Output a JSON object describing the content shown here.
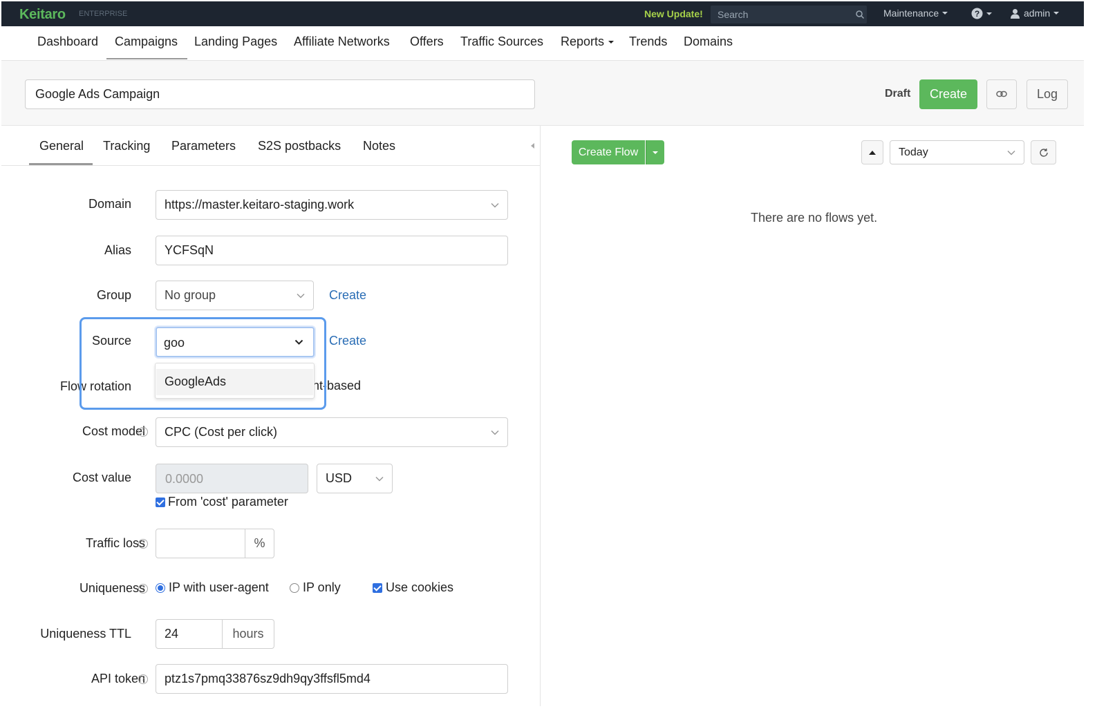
{
  "topbar": {
    "logo": "Keitaro",
    "edition": "ENTERPRISE",
    "new_update": "New Update!",
    "search_placeholder": "Search",
    "maintenance": "Maintenance",
    "user": "admin"
  },
  "nav": {
    "items": [
      "Dashboard",
      "Campaigns",
      "Landing Pages",
      "Affiliate Networks",
      "Offers",
      "Traffic Sources",
      "Reports",
      "Trends",
      "Domains"
    ],
    "active": "Campaigns"
  },
  "campaign": {
    "name": "Google Ads Campaign",
    "status": "Draft",
    "create_label": "Create",
    "log_label": "Log"
  },
  "tabs": {
    "items": [
      "General",
      "Tracking",
      "Parameters",
      "S2S postbacks",
      "Notes"
    ],
    "active": "General"
  },
  "form": {
    "domain": {
      "label": "Domain",
      "value": "https://master.keitaro-staging.work"
    },
    "alias": {
      "label": "Alias",
      "value": "YCFSqN"
    },
    "group": {
      "label": "Group",
      "value": "No group",
      "create": "Create"
    },
    "source": {
      "label": "Source",
      "value": "goo",
      "create": "Create",
      "dropdown_options": [
        "GoogleAds"
      ]
    },
    "flow_rotation": {
      "label": "Flow rotation",
      "visible_value_fragment": "ht-based"
    },
    "cost_model": {
      "label": "Cost model",
      "value": "CPC (Cost per click)"
    },
    "cost_value": {
      "label": "Cost value",
      "placeholder": "0.0000",
      "currency": "USD",
      "from_cost_param": "From 'cost' parameter",
      "from_cost_checked": true
    },
    "traffic_loss": {
      "label": "Traffic loss",
      "value": "",
      "unit": "%"
    },
    "uniqueness": {
      "label": "Uniqueness",
      "options": [
        "IP with user-agent",
        "IP only"
      ],
      "selected": "IP with user-agent",
      "use_cookies": "Use cookies",
      "use_cookies_checked": true
    },
    "uniqueness_ttl": {
      "label": "Uniqueness TTL",
      "value": "24",
      "unit": "hours"
    },
    "api_token": {
      "label": "API token",
      "value": "ptz1s7pmq33876sz9dh9qy3ffsfl5md4"
    }
  },
  "flows": {
    "create_flow": "Create Flow",
    "period": "Today",
    "empty_message": "There are no flows yet."
  },
  "colors": {
    "topbar_bg": "#1d2530",
    "brand_green": "#5cb85c",
    "update_green": "#a6d14a",
    "link_blue": "#2a6db5",
    "highlight_blue": "#5b9bec",
    "checkbox_blue": "#2f6fe0"
  }
}
